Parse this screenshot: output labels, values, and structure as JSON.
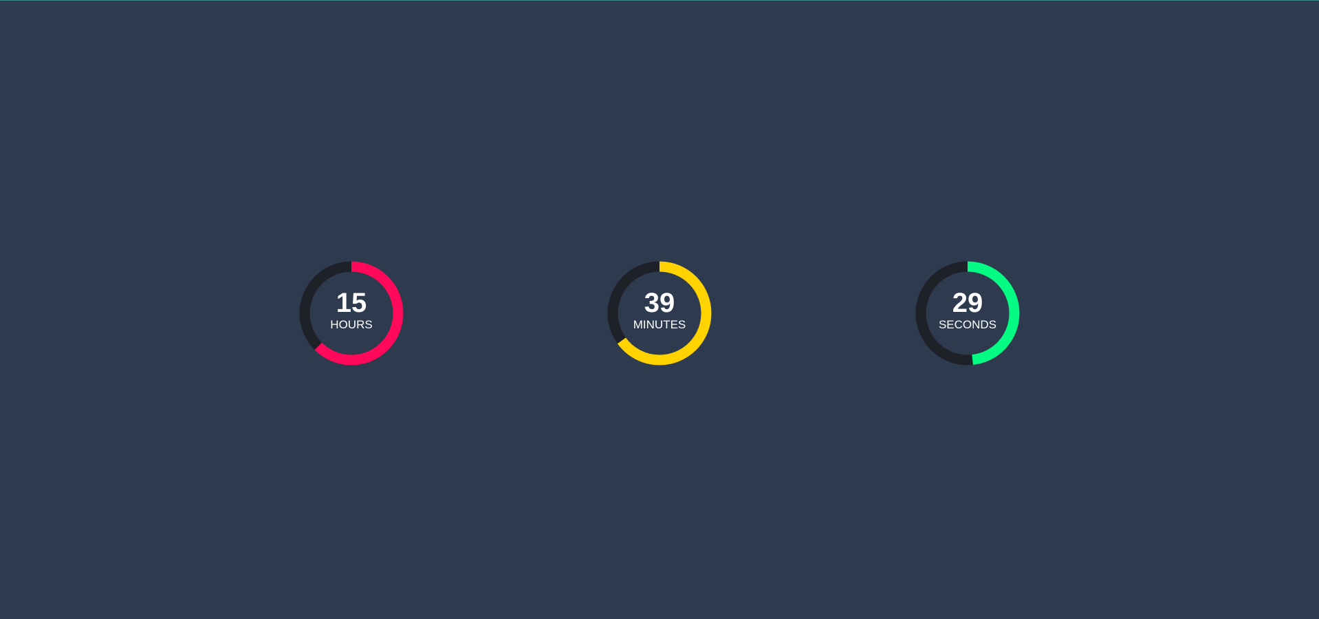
{
  "countdown": {
    "hours": {
      "value": "15",
      "unit": "HOURS",
      "fraction": 0.625,
      "color": "#ff0a5a"
    },
    "minutes": {
      "value": "39",
      "unit": "MINUTES",
      "fraction": 0.65,
      "color": "#ffd200"
    },
    "seconds": {
      "value": "29",
      "unit": "SECONDS",
      "fraction": 0.483,
      "color": "#04fc84"
    }
  },
  "colors": {
    "background": "#2e3b4f",
    "track": "#1f2129",
    "text": "#ffffff"
  }
}
